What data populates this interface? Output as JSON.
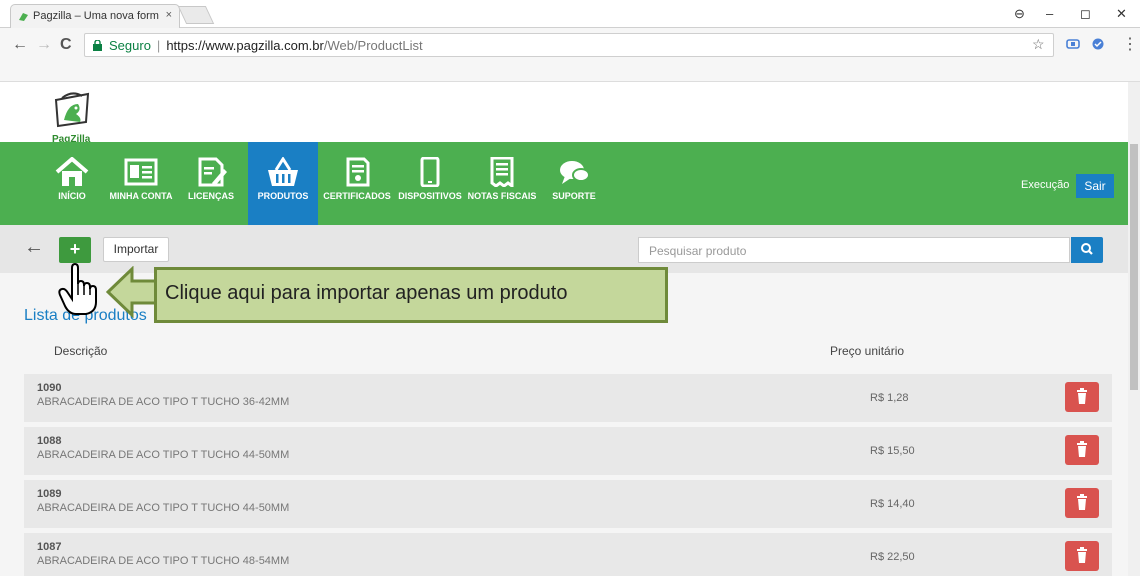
{
  "browser": {
    "tab_title": "Pagzilla – Uma nova form",
    "tab_close": "×",
    "window_controls": [
      "⊖",
      "–",
      "◻",
      "✕"
    ],
    "nav": {
      "back": "←",
      "forward": "→",
      "reload": "C"
    },
    "secure_label": "Seguro",
    "separator": "|",
    "url_host": "https://www.pagzilla.com.br",
    "url_path": "/Web/ProductList",
    "star": "☆",
    "menu": "⋮"
  },
  "site": {
    "logo_text": "PagZilla"
  },
  "nav": {
    "items": [
      {
        "label": "INÍCIO",
        "icon": "home-icon",
        "active": false
      },
      {
        "label": "MINHA CONTA",
        "icon": "id-card-icon",
        "active": false
      },
      {
        "label": "LICENÇAS",
        "icon": "edit-document-icon",
        "active": false
      },
      {
        "label": "PRODUTOS",
        "icon": "shopping-basket-icon",
        "active": true
      },
      {
        "label": "CERTIFICADOS",
        "icon": "certificate-icon",
        "active": false
      },
      {
        "label": "DISPOSITIVOS",
        "icon": "mobile-device-icon",
        "active": false
      },
      {
        "label": "NOTAS FISCAIS",
        "icon": "receipt-icon",
        "active": false
      },
      {
        "label": "SUPORTE",
        "icon": "chat-bubbles-icon",
        "active": false
      }
    ],
    "exec_label": "Execução",
    "logout_label": "Sair",
    "colors": {
      "green": "#4caf50",
      "blue": "#1a7fc4"
    }
  },
  "toolbar": {
    "back": "←",
    "add": "+",
    "import_label": "Importar",
    "search_placeholder": "Pesquisar produto"
  },
  "callout": {
    "text": "Clique aqui para importar apenas um produto"
  },
  "list": {
    "title": "Lista de produtos",
    "columns": {
      "description": "Descrição",
      "price": "Preço unitário"
    },
    "rows": [
      {
        "code": "1090",
        "description": "ABRACADEIRA DE ACO TIPO T TUCHO 36-42MM",
        "price": "R$ 1,28"
      },
      {
        "code": "1088",
        "description": "ABRACADEIRA DE ACO TIPO T TUCHO 44-50MM",
        "price": "R$ 15,50"
      },
      {
        "code": "1089",
        "description": "ABRACADEIRA DE ACO TIPO T TUCHO 44-50MM",
        "price": "R$ 14,40"
      },
      {
        "code": "1087",
        "description": "ABRACADEIRA DE ACO TIPO T TUCHO 48-54MM",
        "price": "R$ 22,50"
      }
    ]
  }
}
